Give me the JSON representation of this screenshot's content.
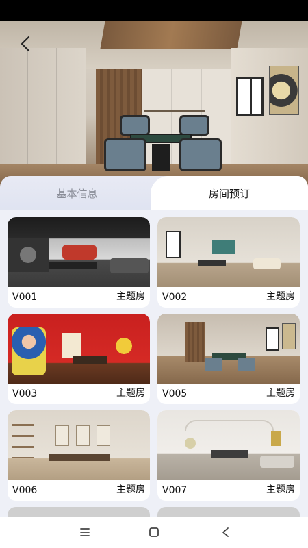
{
  "header": {
    "back_icon": "chevron-left-icon"
  },
  "tabs": [
    {
      "label": "基本信息",
      "active": false
    },
    {
      "label": "房间预订",
      "active": true
    }
  ],
  "rooms": [
    {
      "code": "V001",
      "tag": "主题房"
    },
    {
      "code": "V002",
      "tag": "主题房"
    },
    {
      "code": "V003",
      "tag": "主题房"
    },
    {
      "code": "V005",
      "tag": "主题房"
    },
    {
      "code": "V006",
      "tag": "主题房"
    },
    {
      "code": "V007",
      "tag": "主题房"
    }
  ],
  "nav": {
    "menu_icon": "menu-icon",
    "home_icon": "square-icon",
    "back_icon": "triangle-back-icon"
  },
  "colors": {
    "active_tab_text": "#1a1a1a",
    "inactive_tab_text": "#8a8d98",
    "background": "#eef0f7"
  }
}
